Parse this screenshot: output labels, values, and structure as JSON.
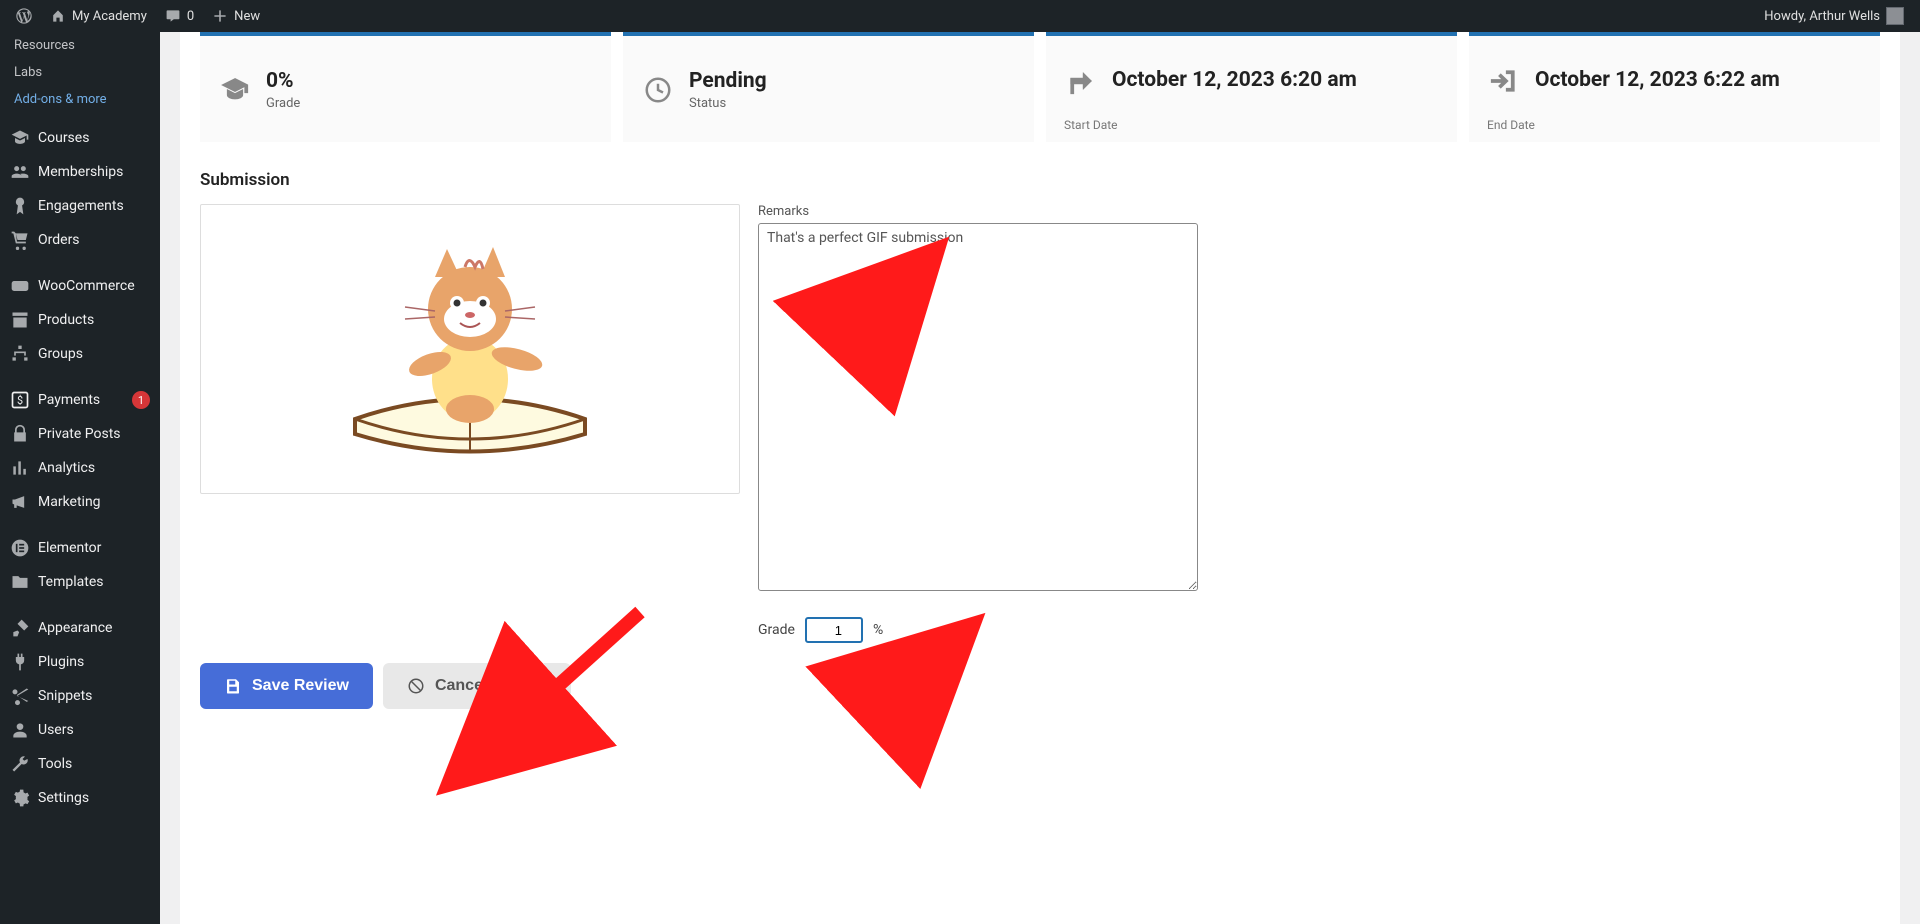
{
  "adminbar": {
    "site_name": "My Academy",
    "comments_count": "0",
    "new_label": "New",
    "howdy": "Howdy, Arthur Wells"
  },
  "sidebar": {
    "sub_items": [
      {
        "label": "Resources"
      },
      {
        "label": "Labs"
      },
      {
        "label": "Add-ons & more",
        "active": true
      }
    ],
    "items": [
      {
        "icon": "cap",
        "label": "Courses"
      },
      {
        "icon": "users",
        "label": "Memberships"
      },
      {
        "icon": "award",
        "label": "Engagements"
      },
      {
        "icon": "cart",
        "label": "Orders"
      },
      {
        "icon": "woo",
        "label": "WooCommerce"
      },
      {
        "icon": "archive",
        "label": "Products"
      },
      {
        "icon": "sitemap",
        "label": "Groups"
      },
      {
        "icon": "dollar",
        "label": "Payments",
        "badge": "1"
      },
      {
        "icon": "lock",
        "label": "Private Posts"
      },
      {
        "icon": "chart",
        "label": "Analytics"
      },
      {
        "icon": "megaphone",
        "label": "Marketing"
      },
      {
        "icon": "elementor",
        "label": "Elementor"
      },
      {
        "icon": "folder",
        "label": "Templates"
      },
      {
        "icon": "brush",
        "label": "Appearance"
      },
      {
        "icon": "plug",
        "label": "Plugins"
      },
      {
        "icon": "scissors",
        "label": "Snippets"
      },
      {
        "icon": "person",
        "label": "Users"
      },
      {
        "icon": "wrench",
        "label": "Tools"
      },
      {
        "icon": "gear",
        "label": "Settings"
      }
    ]
  },
  "cards": {
    "grade": {
      "value": "0%",
      "label": "Grade"
    },
    "status": {
      "value": "Pending",
      "label": "Status"
    },
    "start": {
      "value": "October 12, 2023 6:20 am",
      "label": "Start Date"
    },
    "end": {
      "value": "October 12, 2023 6:22 am",
      "label": "End Date"
    }
  },
  "section_title": "Submission",
  "remarks": {
    "label": "Remarks",
    "value": "That's a perfect GIF submission"
  },
  "grade_input": {
    "label": "Grade",
    "value": "1",
    "suffix": "%"
  },
  "buttons": {
    "save": "Save Review",
    "cancel": "Cancel Review"
  }
}
